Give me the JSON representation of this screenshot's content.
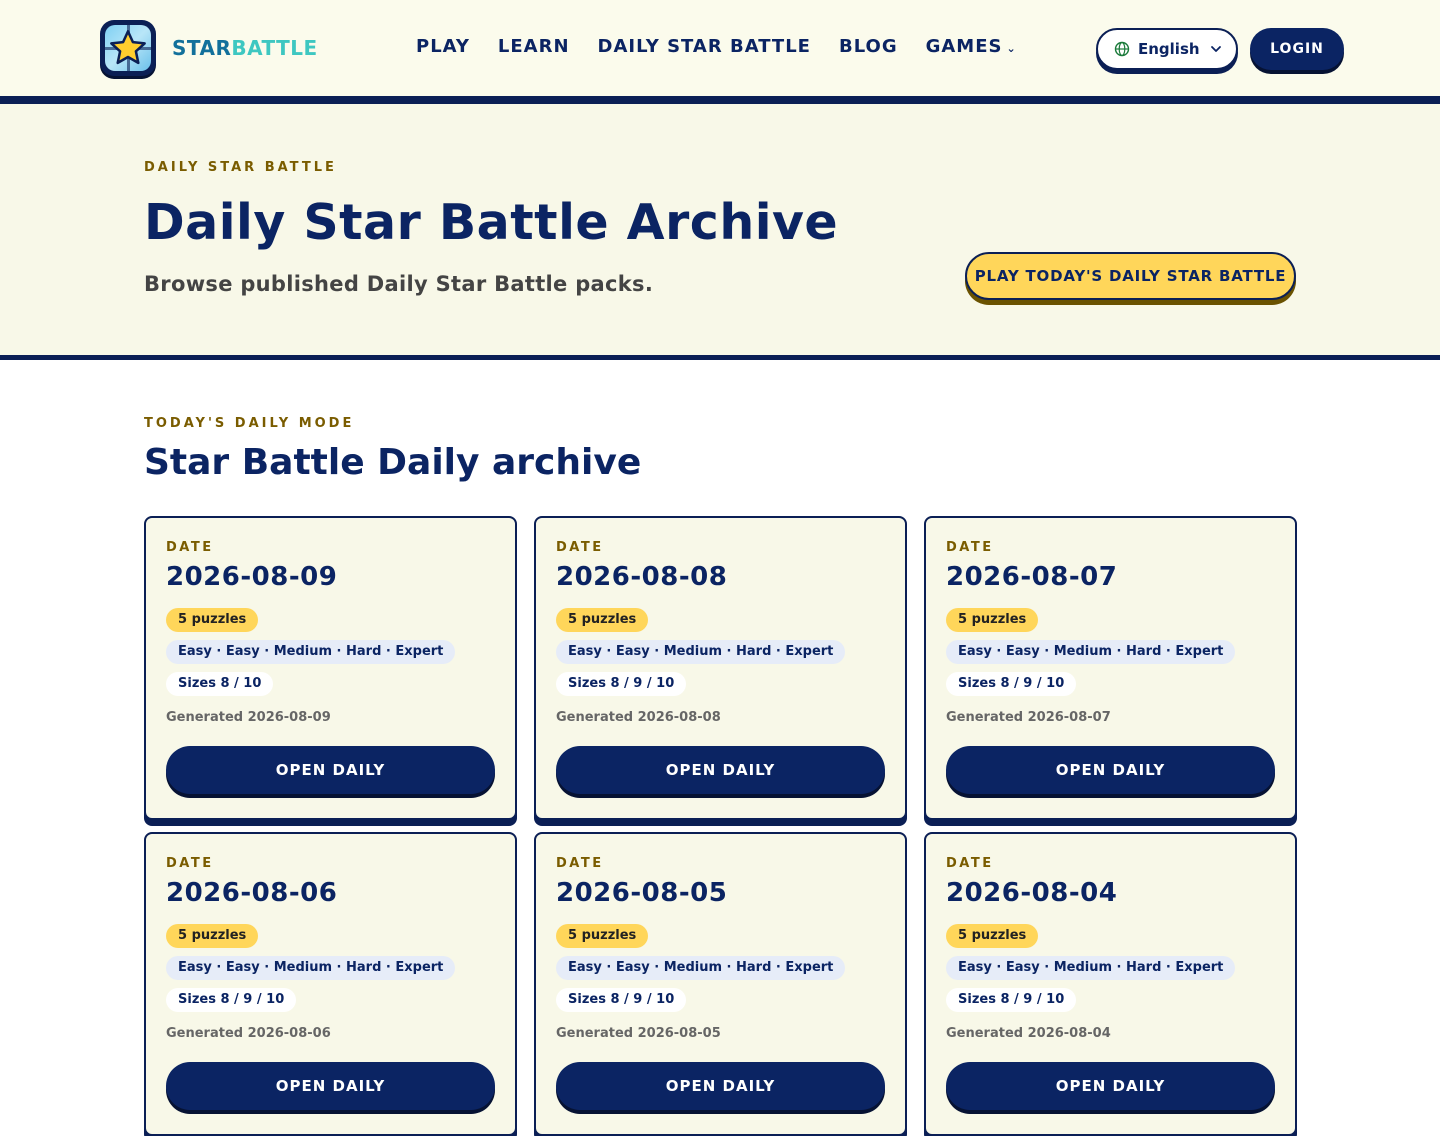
{
  "header": {
    "brand_part1": "STAR",
    "brand_part2": "BATTLE",
    "nav": [
      {
        "label": "PLAY"
      },
      {
        "label": "LEARN"
      },
      {
        "label": "DAILY STAR BATTLE"
      },
      {
        "label": "BLOG"
      },
      {
        "label": "GAMES"
      }
    ],
    "language": "English",
    "login": "LOGIN"
  },
  "hero": {
    "eyebrow": "DAILY STAR BATTLE",
    "title": "Daily Star Battle Archive",
    "subtitle": "Browse published Daily Star Battle packs.",
    "cta": "PLAY TODAY'S DAILY STAR BATTLE"
  },
  "section": {
    "eyebrow": "TODAY'S DAILY MODE",
    "title": "Star Battle Daily archive"
  },
  "cards": [
    {
      "label": "DATE",
      "date": "2026-08-09",
      "count": "5 puzzles",
      "levels": "Easy · Easy · Medium · Hard · Expert",
      "sizes": "Sizes 8 / 10",
      "generated": "Generated 2026-08-09",
      "button": "OPEN DAILY"
    },
    {
      "label": "DATE",
      "date": "2026-08-08",
      "count": "5 puzzles",
      "levels": "Easy · Easy · Medium · Hard · Expert",
      "sizes": "Sizes 8 / 9 / 10",
      "generated": "Generated 2026-08-08",
      "button": "OPEN DAILY"
    },
    {
      "label": "DATE",
      "date": "2026-08-07",
      "count": "5 puzzles",
      "levels": "Easy · Easy · Medium · Hard · Expert",
      "sizes": "Sizes 8 / 9 / 10",
      "generated": "Generated 2026-08-07",
      "button": "OPEN DAILY"
    },
    {
      "label": "DATE",
      "date": "2026-08-06",
      "count": "5 puzzles",
      "levels": "Easy · Easy · Medium · Hard · Expert",
      "sizes": "Sizes 8 / 9 / 10",
      "generated": "Generated 2026-08-06",
      "button": "OPEN DAILY"
    },
    {
      "label": "DATE",
      "date": "2026-08-05",
      "count": "5 puzzles",
      "levels": "Easy · Easy · Medium · Hard · Expert",
      "sizes": "Sizes 8 / 9 / 10",
      "generated": "Generated 2026-08-05",
      "button": "OPEN DAILY"
    },
    {
      "label": "DATE",
      "date": "2026-08-04",
      "count": "5 puzzles",
      "levels": "Easy · Easy · Medium · Hard · Expert",
      "sizes": "Sizes 8 / 9 / 10",
      "generated": "Generated 2026-08-04",
      "button": "OPEN DAILY"
    }
  ],
  "colors": {
    "navy": "#0b2463",
    "cream": "#f8f8e8",
    "yellow": "#ffd65a",
    "eyebrow": "#7a5c00",
    "brand_blue": "#12709b",
    "brand_teal": "#3ec7c1"
  },
  "icons": {
    "logo": "star-grid-logo-icon",
    "language": "globe-icon",
    "dropdown": "chevron-down-icon"
  }
}
